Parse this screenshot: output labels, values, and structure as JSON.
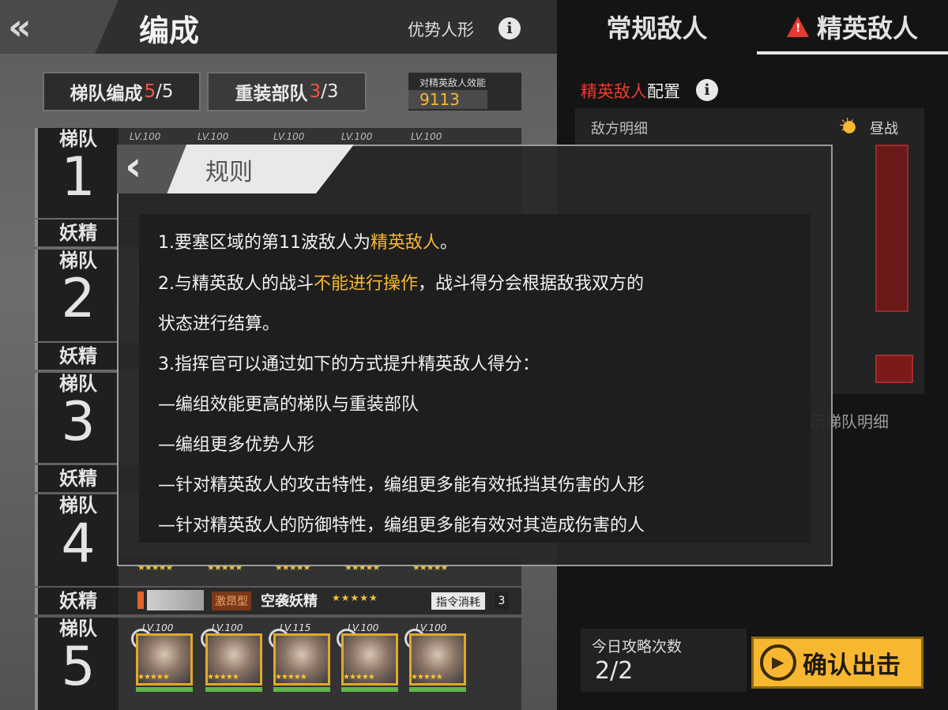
{
  "header": {
    "back_glyph": "«",
    "title": "编成",
    "advantage_label": "优势人形",
    "info_glyph": "i"
  },
  "formation_tabs": [
    {
      "label": "梯队编成",
      "count_hi": "5",
      "count_rest": "/5"
    },
    {
      "label": "重装部队",
      "count_hi": "3",
      "count_rest": "/3"
    }
  ],
  "efficiency": {
    "label": "对精英敌人效能",
    "value": "9113"
  },
  "echelon_label": "梯队",
  "fairy_label": "妖精",
  "echelons": [
    "1",
    "2",
    "3",
    "4",
    "5"
  ],
  "fairy": {
    "type": "激昂型",
    "name": "空袭妖精",
    "stars": "★★★★★",
    "command_label": "指令消耗",
    "command_value": "3"
  },
  "dolls_echelon5": [
    {
      "level": "LV.100",
      "stars": "★★★★★"
    },
    {
      "level": "LV.100",
      "stars": "★★★★★"
    },
    {
      "level": "LV.115",
      "stars": "★★★★★"
    },
    {
      "level": "LV.100",
      "stars": "★★★★★"
    },
    {
      "level": "LV.100",
      "stars": "★★★★★"
    }
  ],
  "dolls_echelon1_levels": [
    "LV.100",
    "LV.100",
    "LV.100",
    "LV.100",
    "LV.100"
  ],
  "enemy_tabs": {
    "normal": "常规敌人",
    "elite": "精英敌人"
  },
  "elite_config": {
    "red": "精英敌人",
    "rest": "配置"
  },
  "enemy_detail_label": "敌方明细",
  "day_battle": "昼战",
  "show_echelon_detail": "显示梯队明细",
  "attempts": {
    "label": "今日攻略次数",
    "value": "2/2"
  },
  "confirm_label": "确认出击",
  "modal": {
    "back_glyph": "‹",
    "title": "规则",
    "rules": [
      {
        "pre": "1.要塞区域的第11波敌人为",
        "hl": "精英敌人",
        "post": "。"
      },
      {
        "pre": "2.与精英敌人的战斗",
        "hl": "不能进行操作",
        "post": "，战斗得分会根据敌我双方的"
      },
      {
        "pre": "状态进行结算。",
        "hl": "",
        "post": ""
      },
      {
        "pre": "3.指挥官可以通过如下的方式提升精英敌人得分：",
        "hl": "",
        "post": ""
      },
      {
        "pre": "—编组效能更高的梯队与重装部队",
        "hl": "",
        "post": ""
      },
      {
        "pre": "—编组更多优势人形",
        "hl": "",
        "post": ""
      },
      {
        "pre": "—针对精英敌人的攻击特性，编组更多能有效抵挡其伤害的人形",
        "hl": "",
        "post": ""
      },
      {
        "pre": "—针对精英敌人的防御特性，编组更多能有效对其造成伤害的人",
        "hl": "",
        "post": ""
      }
    ]
  },
  "colors": {
    "accent": "#f7b731",
    "danger": "#ec3b32",
    "highlight_text": "#f7b731"
  }
}
